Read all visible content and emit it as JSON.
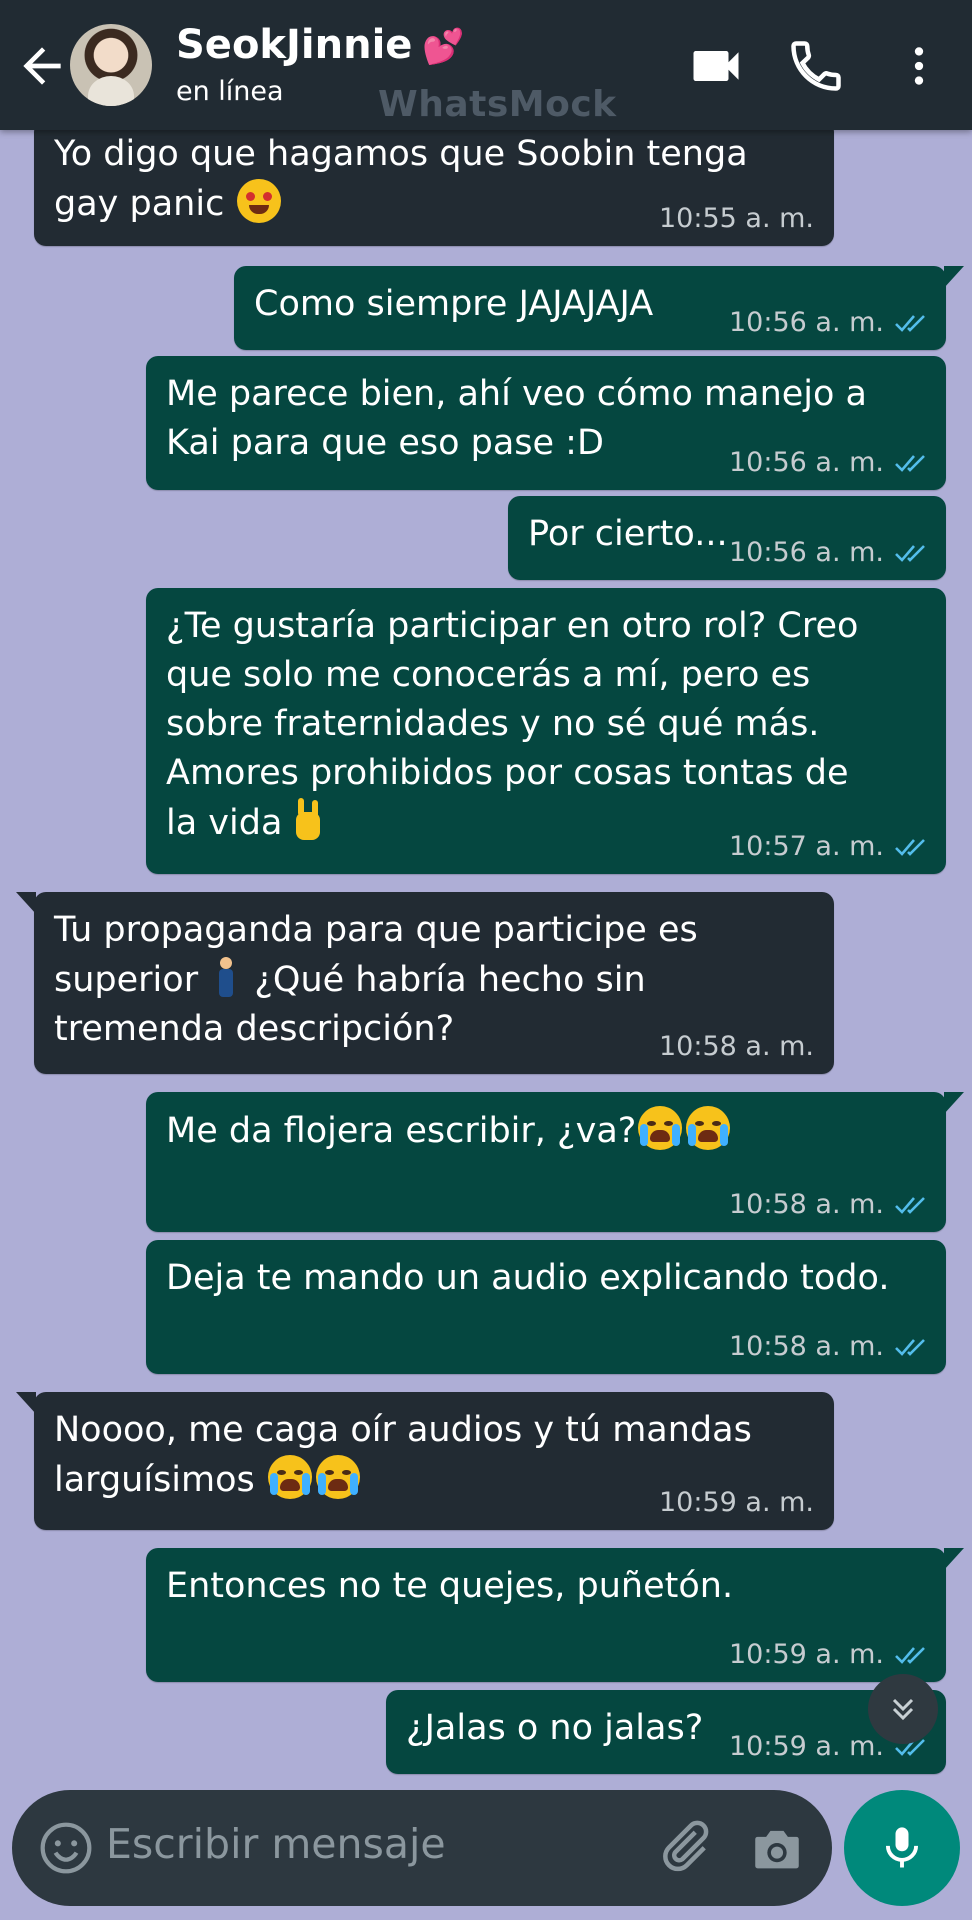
{
  "header": {
    "contact_name": "SeokJinnie",
    "name_emoji": "💕",
    "status": "en línea",
    "watermark": "WhatsMock"
  },
  "messages": [
    {
      "dir": "in",
      "text": "Yo digo que hagamos que Soobin tenga\ngay panic",
      "emoji": "star-eyes",
      "time": "10:55 a. m."
    },
    {
      "dir": "out",
      "text": "Como siempre JAJAJAJA",
      "time": "10:56 a. m.",
      "read": true
    },
    {
      "dir": "out",
      "text": "Me parece bien, ahí veo cómo manejo a\nKai para que eso pase :D",
      "time": "10:56 a. m.",
      "read": true
    },
    {
      "dir": "out",
      "text": "Por cierto...",
      "time": "10:56 a. m.",
      "read": true
    },
    {
      "dir": "out",
      "text": "¿Te gustaría participar en otro rol? Creo\nque solo me conocerás a mí, pero es\nsobre fraternidades y no sé qué más.\nAmores prohibidos por cosas tontas de\nla vida",
      "emoji": "rock-hand",
      "time": "10:57 a. m.",
      "read": true
    },
    {
      "dir": "in",
      "text_a": "Tu propaganda para que participe es\nsuperior ",
      "emoji": "person-standing",
      "text_b": " ¿Qué habría hecho sin\ntremenda descripción?",
      "time": "10:58 a. m."
    },
    {
      "dir": "out",
      "text": "Me da flojera escribir, ¿va?",
      "emoji": "crying-x2",
      "time": "10:58 a. m.",
      "read": true
    },
    {
      "dir": "out",
      "text": "Deja te mando un audio explicando todo.",
      "time": "10:58 a. m.",
      "read": true
    },
    {
      "dir": "in",
      "text": "Noooo, me caga oír audios y tú mandas\nlarguísimos",
      "emoji": "crying-x2",
      "time": "10:59 a. m."
    },
    {
      "dir": "out",
      "text": "Entonces no te quejes, puñetón.",
      "time": "10:59 a. m.",
      "read": true
    },
    {
      "dir": "out",
      "text": "¿Jalas o no jalas?",
      "time": "10:59 a. m.",
      "read": true
    }
  ],
  "input": {
    "placeholder": "Escribir mensaje"
  },
  "icons": {
    "back": "back-arrow-icon",
    "video": "video-call-icon",
    "call": "phone-call-icon",
    "menu": "more-options-icon",
    "emoji": "emoji-icon",
    "attach": "attach-icon",
    "camera": "camera-icon",
    "mic": "microphone-icon",
    "scroll": "scroll-down-icon"
  },
  "colors": {
    "chat_bg": "#aeaed6",
    "header_bg": "#212b33",
    "incoming_bubble": "#222b33",
    "outgoing_bubble": "#054740",
    "read_ticks": "#53bdeb",
    "accent": "#00897b"
  }
}
